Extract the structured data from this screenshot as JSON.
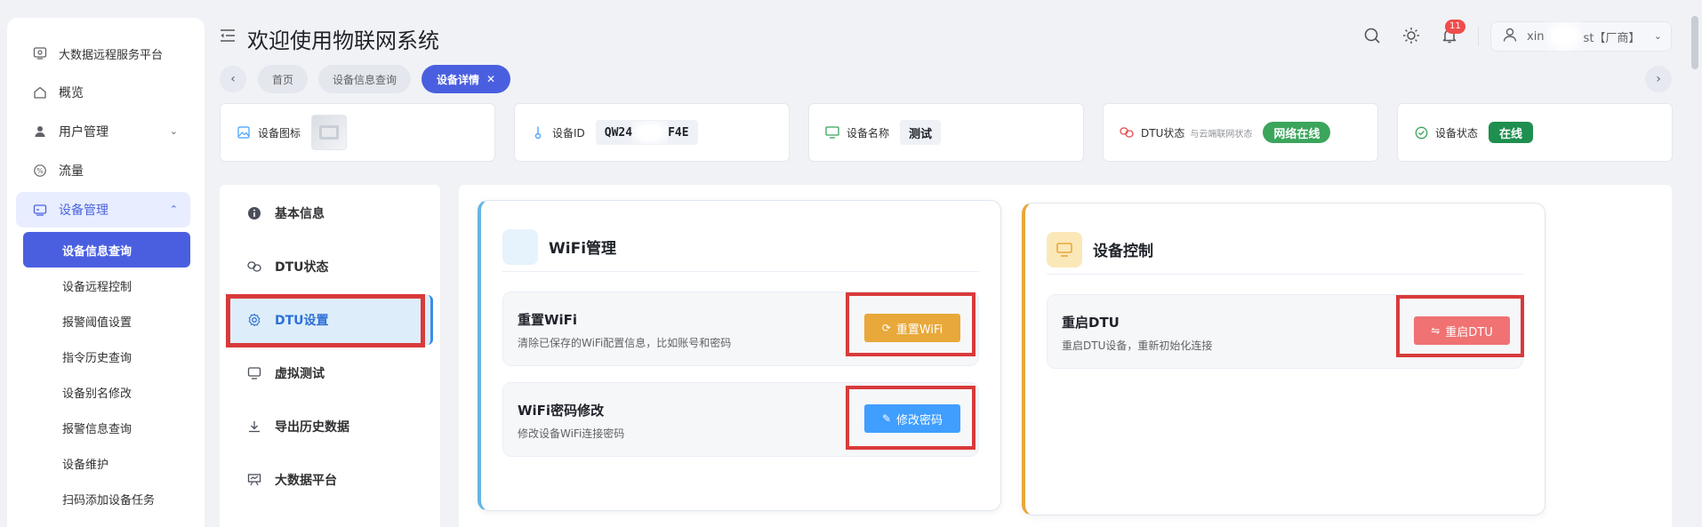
{
  "app": {
    "title": "欢迎使用物联网系统"
  },
  "sidebar": {
    "items": [
      {
        "label": "大数据远程服务平台",
        "icon": "monitor-icon"
      },
      {
        "label": "概览",
        "icon": "home-icon"
      },
      {
        "label": "用户管理",
        "icon": "user-icon"
      },
      {
        "label": "流量",
        "icon": "percent-icon"
      },
      {
        "label": "设备管理",
        "icon": "device-icon"
      }
    ],
    "sub_items": [
      "设备信息查询",
      "设备远程控制",
      "报警阈值设置",
      "指令历史查询",
      "设备别名修改",
      "报警信息查询",
      "设备维护",
      "扫码添加设备任务"
    ]
  },
  "header": {
    "notification_count": "11",
    "user_name": "xin",
    "user_role": "st【厂商】"
  },
  "tabs": [
    "首页",
    "设备信息查询",
    "设备详情"
  ],
  "info_cards": {
    "icon": {
      "label": "设备图标"
    },
    "id": {
      "label": "设备ID",
      "value": "QW24",
      "value_tail": "F4E"
    },
    "name": {
      "label": "设备名称",
      "value": "测试"
    },
    "dtu": {
      "label": "DTU状态",
      "sub": "与云端联网状态",
      "value": "网络在线"
    },
    "status": {
      "label": "设备状态",
      "value": "在线"
    }
  },
  "settings_menu": [
    {
      "label": "基本信息",
      "icon": "info-icon"
    },
    {
      "label": "DTU状态",
      "icon": "link-icon"
    },
    {
      "label": "DTU设置",
      "icon": "gear-icon"
    },
    {
      "label": "虚拟测试",
      "icon": "screen-icon"
    },
    {
      "label": "导出历史数据",
      "icon": "download-icon"
    },
    {
      "label": "大数据平台",
      "icon": "dashboard-icon"
    }
  ],
  "wifi_card": {
    "title": "WiFi管理",
    "actions": [
      {
        "title": "重置WiFi",
        "desc": "清除已保存的WiFi配置信息，比如账号和密码",
        "button": "重置WiFi"
      },
      {
        "title": "WiFi密码修改",
        "desc": "修改设备WiFi连接密码",
        "button": "修改密码"
      }
    ]
  },
  "dtu_card": {
    "title": "设备控制",
    "actions": [
      {
        "title": "重启DTU",
        "desc": "重启DTU设备，重新初始化连接",
        "button": "重启DTU"
      }
    ]
  },
  "colors": {
    "primary": "#4a5fe0",
    "online_green": "#3ba55c",
    "status_green": "#1e8f4e",
    "warning_orange": "#e8a83a",
    "info_blue": "#409eff",
    "danger_red": "#f07272",
    "highlight_red": "#d93a3a"
  }
}
